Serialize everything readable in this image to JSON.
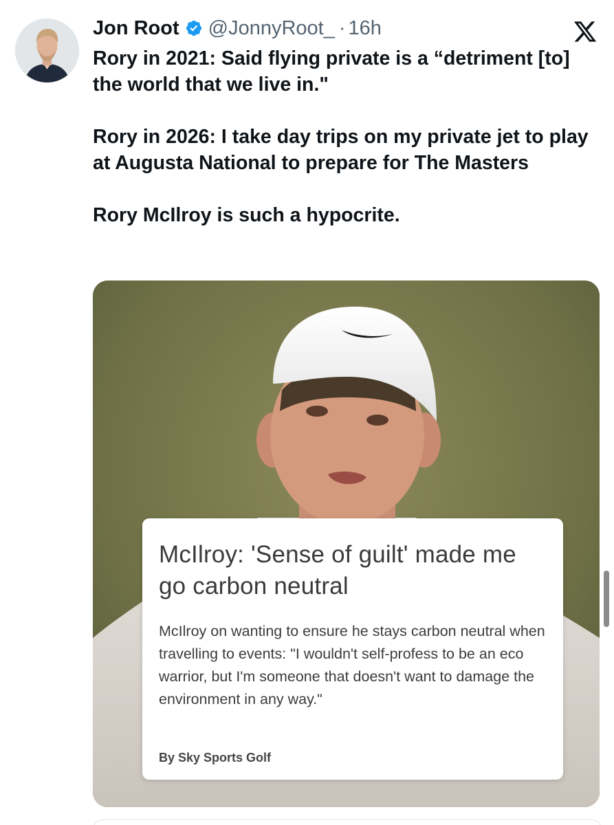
{
  "author": {
    "name": "Jon Root",
    "handle": "@JonnyRoot_",
    "separator": "·",
    "time": "16h",
    "verified_icon": "verified-badge-icon",
    "verified_color": "#1d9bf0"
  },
  "tweet": {
    "paragraphs": [
      "Rory in 2021: Said flying private is a “detriment [to] the world that we live in.\"",
      "Rory in 2026: I take day trips on my private jet to play at Augusta National to prepare for The Masters",
      "Rory McIlroy is such a hypocrite."
    ]
  },
  "article": {
    "title": "McIlroy: 'Sense of guilt' made me go carbon neutral",
    "description": "McIlroy on wanting to ensure he stays carbon neutral when travelling to events: \"I wouldn't self-profess to be an eco warrior, but I'm someone that doesn't want to damage the environment in any way.\"",
    "byline": "By Sky Sports Golf"
  },
  "icons": {
    "platform_logo": "x-logo-icon"
  },
  "colors": {
    "text_primary": "#0f1419",
    "text_secondary": "#536471",
    "verified_blue": "#1d9bf0"
  }
}
